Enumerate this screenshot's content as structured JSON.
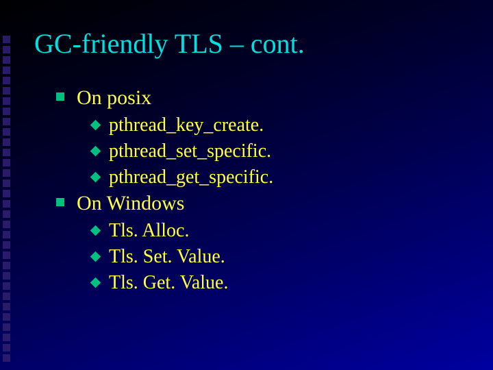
{
  "title": "GC-friendly TLS – cont.",
  "bullets": [
    {
      "text": "On posix",
      "children": [
        "pthread_key_create.",
        "pthread_set_specific.",
        "pthread_get_specific."
      ]
    },
    {
      "text": "On Windows",
      "children": [
        "Tls. Alloc.",
        "Tls. Set. Value.",
        "Tls. Get. Value."
      ]
    }
  ]
}
